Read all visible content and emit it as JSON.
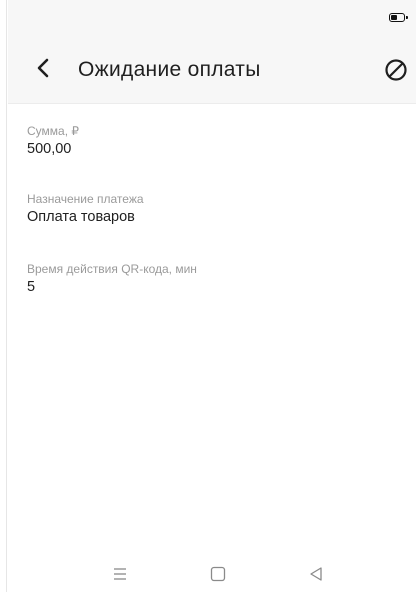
{
  "app": {
    "title": "Ожидание оплаты"
  },
  "toolbar": {
    "back_icon": "chevron-left-icon",
    "cancel_icon": "cancel-circle-icon"
  },
  "fields": [
    {
      "label": "Сумма, ₽",
      "value": "500,00"
    },
    {
      "label": "Назначение платежа",
      "value": "Оплата товаров"
    },
    {
      "label": "Время действия QR-кода, мин",
      "value": "5"
    }
  ],
  "status_bar": {
    "battery_icon": "battery-icon"
  },
  "nav_bar": {
    "menu_icon": "menu-icon",
    "home_icon": "home-square-icon",
    "back_icon": "back-triangle-icon"
  },
  "colors": {
    "header_bg": "#f7f7f7",
    "text_primary": "#1f1f1f",
    "text_secondary": "#9a9a9a",
    "nav_icon": "#8a8a8a"
  }
}
